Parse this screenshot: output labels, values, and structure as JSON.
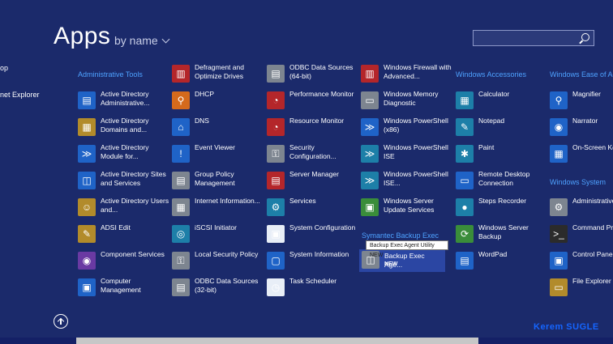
{
  "title": "Apps",
  "sort_label": "by name",
  "search": {
    "placeholder": ""
  },
  "partial_items": {
    "item1": "op",
    "item2": "net Explorer"
  },
  "headers": {
    "admin_tools": "Administrative Tools",
    "win_accessories": "Windows Accessories",
    "win_ease": "Windows Ease of Acce",
    "win_system": "Windows System",
    "symantec": "Symantec Backup Exec"
  },
  "apps": {
    "c1": [
      "Active Directory Administrative...",
      "Active Directory Domains and...",
      "Active Directory Module for...",
      "Active Directory Sites and Services",
      "Active Directory Users and...",
      "ADSI Edit",
      "Component Services",
      "Computer Management"
    ],
    "c2": [
      "Defragment and Optimize Drives",
      "DHCP",
      "DNS",
      "Event Viewer",
      "Group Policy Management",
      "Internet Information...",
      "iSCSI Initiator",
      "Local Security Policy",
      "ODBC Data Sources (32-bit)"
    ],
    "c3": [
      "ODBC Data Sources (64-bit)",
      "Performance Monitor",
      "Resource Monitor",
      "Security Configuration...",
      "Server Manager",
      "Services",
      "System Configuration",
      "System Information",
      "Task Scheduler"
    ],
    "c4": [
      "Windows Firewall with Advanced...",
      "Windows Memory Diagnostic",
      "Windows PowerShell (x86)",
      "Windows PowerShell ISE",
      "Windows PowerShell ISE...",
      "Windows Server Update Services",
      "Backup Exec Age..."
    ],
    "c5": [
      "Calculator",
      "Notepad",
      "Paint",
      "Remote Desktop Connection",
      "Steps Recorder",
      "Windows Server Backup",
      "WordPad"
    ],
    "c6": [
      "Magnifier",
      "Narrator",
      "On-Screen Keyboard",
      "Administrative Tools",
      "Command Prompt",
      "Control Panel",
      "File Explorer"
    ]
  },
  "new_badge": "NEW",
  "tooltip": "Backup Exec Agent Utility NEW",
  "signature": "Kerem SUGLE",
  "colors": {
    "background": "#1b2a6b",
    "accent_header": "#4ea2ff",
    "selected": "#2b46a3"
  }
}
